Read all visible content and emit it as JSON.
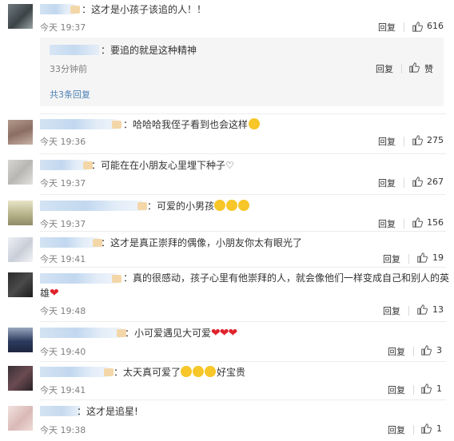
{
  "colors": {
    "link": "#4c80b5",
    "heart": "#e0222b",
    "muted": "#808080",
    "text": "#333333"
  },
  "comments": [
    {
      "prefix": "：",
      "text": "这才是小孩子该追的人！！",
      "time": "今天 19:37",
      "reply": "回复",
      "likes": "616"
    },
    {
      "prefix": "：",
      "text": "哈哈哈我侄子看到也会这样",
      "time": "今天 19:36",
      "reply": "回复",
      "likes": "275"
    },
    {
      "prefix": "：",
      "text": "可能在在小朋友心里埋下种子♡",
      "time": "今天 19:37",
      "reply": "回复",
      "likes": "267"
    },
    {
      "prefix": "：",
      "text": "可爱的小男孩",
      "time": "今天 19:37",
      "reply": "回复",
      "likes": "156"
    },
    {
      "prefix": "：",
      "text": "这才是真正崇拜的偶像，小朋友你太有眼光了",
      "time": "今天 19:41",
      "reply": "回复",
      "likes": "19"
    },
    {
      "prefix": "：",
      "text": "真的很感动，孩子心里有他崇拜的人，就会像他们一样变成自己和别人的英",
      "text2": "雄",
      "time": "今天 19:48",
      "reply": "回复",
      "likes": "13"
    },
    {
      "prefix": "：",
      "text": "小可爱遇见大可爱",
      "time": "今天 19:40",
      "reply": "回复",
      "likes": "3"
    },
    {
      "prefix": "：",
      "text": "太天真可爱了",
      "text_after": "好宝贵",
      "time": "今天 19:41",
      "reply": "回复",
      "likes": "1"
    },
    {
      "prefix": "：",
      "text": "这才是追星!",
      "time": "今天 19:38",
      "reply": "回复",
      "likes": "1"
    }
  ],
  "sub_reply": {
    "prefix": "：",
    "text": "要追的就是这种精神",
    "time": "33分钟前",
    "reply": "回复",
    "like_label": "赞"
  },
  "more_replies": "共3条回复",
  "icons": {
    "like": "thumbs-up-icon",
    "emoji_laugh": "laughing-emoji-icon",
    "emoji_cry": "crying-emoji-icon",
    "heart": "red-heart-icon"
  }
}
